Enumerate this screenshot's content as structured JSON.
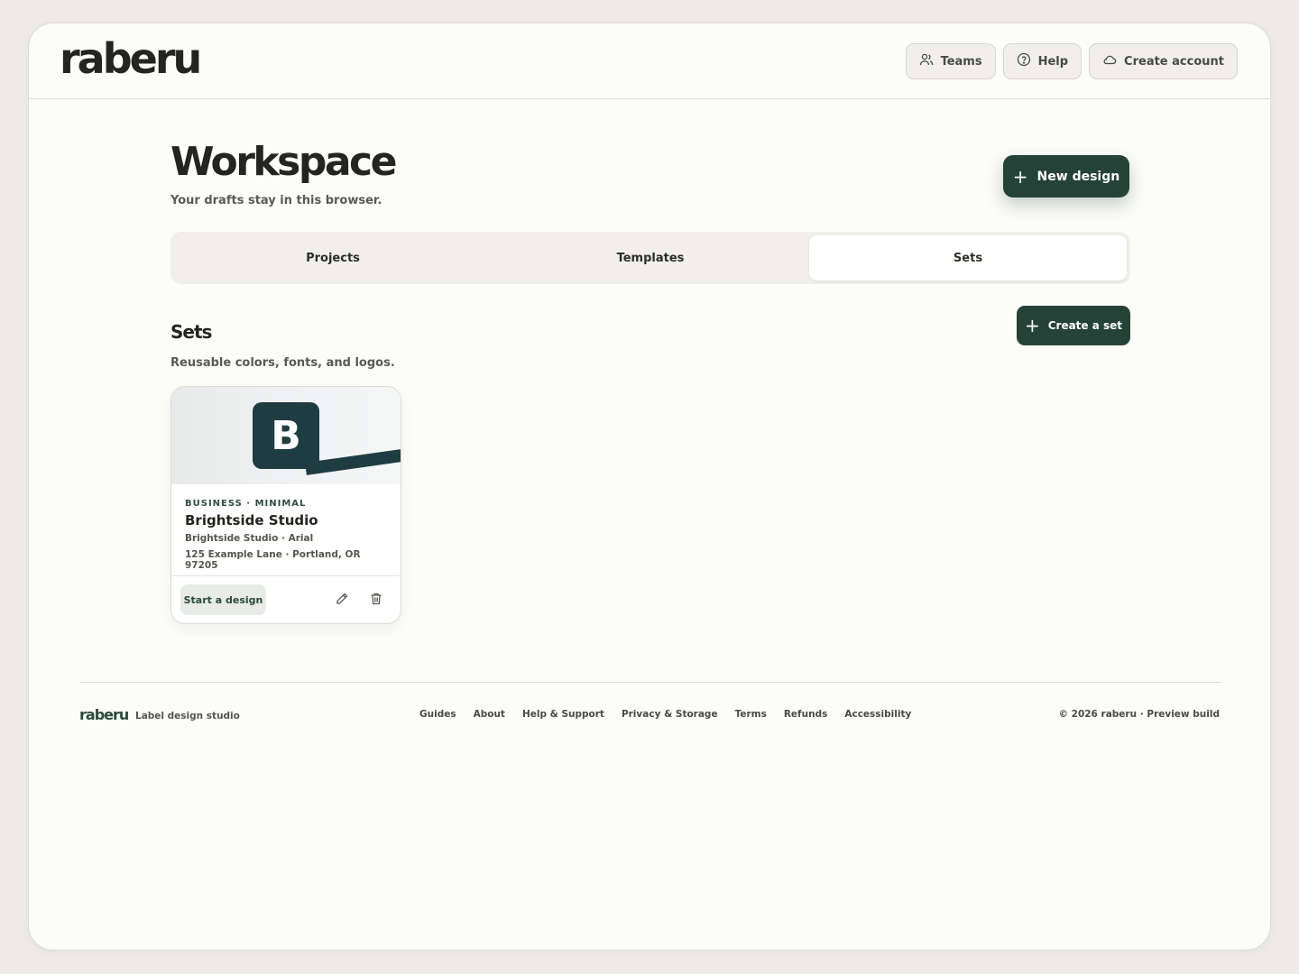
{
  "header": {
    "logo": "raberu",
    "buttons": [
      {
        "label": "Teams",
        "icon": "users-icon"
      },
      {
        "label": "Help",
        "icon": "help-circle-icon"
      },
      {
        "label": "Create account",
        "icon": "cloud-icon"
      }
    ]
  },
  "workspace": {
    "title": "Workspace",
    "subtitle": "Your drafts stay in this browser.",
    "new_design_label": "New design"
  },
  "tabs": [
    {
      "label": "Projects",
      "active": false
    },
    {
      "label": "Templates",
      "active": false
    },
    {
      "label": "Sets",
      "active": true
    }
  ],
  "sets": {
    "title": "Sets",
    "subtitle": "Reusable colors, fonts, and logos.",
    "create_label": "Create a set",
    "cards": [
      {
        "badge_letter": "B",
        "category": "BUSINESS · MINIMAL",
        "name": "Brightside Studio",
        "line1": "Brightside Studio · Arial",
        "line2": "125 Example Lane · Portland, OR 97205",
        "start_label": "Start a design"
      }
    ]
  },
  "footer": {
    "logo": "raberu",
    "tagline": "Label design studio",
    "links": [
      "Guides",
      "About",
      "Help & Support",
      "Privacy & Storage",
      "Terms",
      "Refunds",
      "Accessibility"
    ],
    "copyright": "© 2026 raberu · Preview build"
  },
  "colors": {
    "accent": "#244238",
    "badge": "#1f3d41",
    "background": "#fcfcf9"
  }
}
